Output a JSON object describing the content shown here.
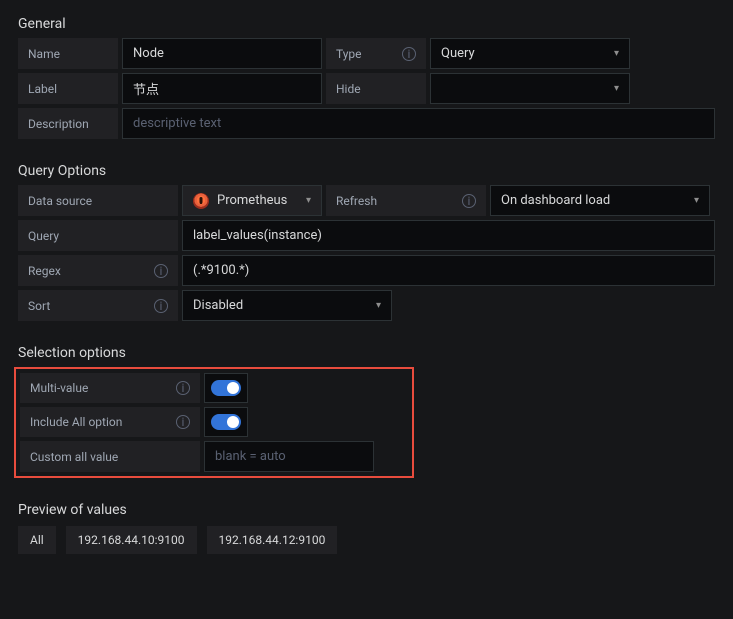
{
  "general": {
    "heading": "General",
    "name_label": "Name",
    "name_value": "Node",
    "type_label": "Type",
    "type_value": "Query",
    "label_label": "Label",
    "label_value": "节点",
    "hide_label": "Hide",
    "hide_value": "",
    "description_label": "Description",
    "description_placeholder": "descriptive text"
  },
  "query_options": {
    "heading": "Query Options",
    "datasource_label": "Data source",
    "datasource_value": "Prometheus",
    "refresh_label": "Refresh",
    "refresh_value": "On dashboard load",
    "query_label": "Query",
    "query_value": "label_values(instance)",
    "regex_label": "Regex",
    "regex_value": "(.*9100.*)",
    "sort_label": "Sort",
    "sort_value": "Disabled"
  },
  "selection_options": {
    "heading": "Selection options",
    "multi_value_label": "Multi-value",
    "include_all_label": "Include All option",
    "custom_all_label": "Custom all value",
    "custom_all_placeholder": "blank = auto"
  },
  "preview": {
    "heading": "Preview of values",
    "values": [
      "All",
      "192.168.44.10:9100",
      "192.168.44.12:9100"
    ]
  },
  "icons": {
    "info": "i"
  }
}
